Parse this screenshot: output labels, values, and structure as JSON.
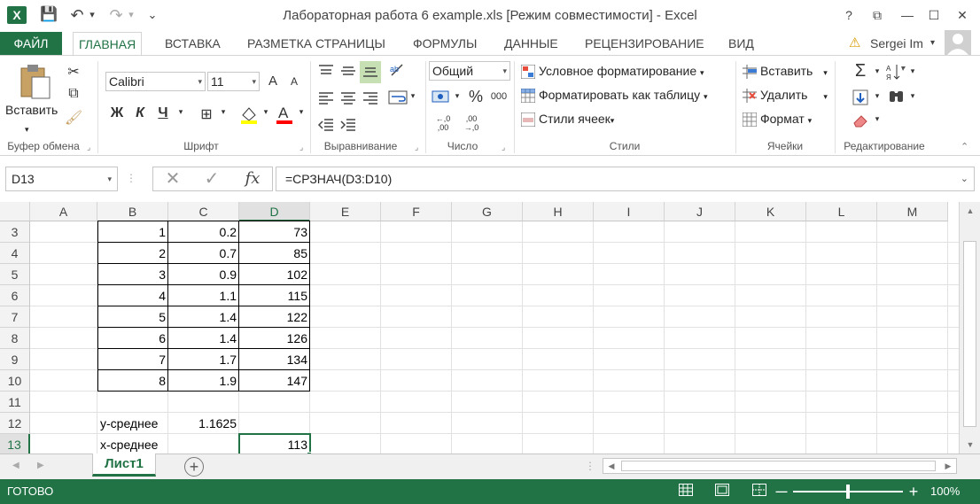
{
  "window": {
    "title": "Лабораторная работа 6 example.xls  [Режим совместимости] - Excel",
    "help": "?",
    "ribbon_options": "⧉",
    "minimize": "—",
    "maximize": "☐",
    "close": "✕"
  },
  "qat": {
    "logo": "X",
    "save": "💾",
    "undo": "↶",
    "undo_drop": "▾",
    "redo": "↷",
    "redo_drop": "▾",
    "customize": "⌄"
  },
  "tabs": {
    "file": "ФАЙЛ",
    "items": [
      "ГЛАВНАЯ",
      "ВСТАВКА",
      "РАЗМЕТКА СТРАНИЦЫ",
      "ФОРМУЛЫ",
      "ДАННЫЕ",
      "РЕЦЕНЗИРОВАНИЕ",
      "ВИД"
    ],
    "active": "ГЛАВНАЯ",
    "user": "Sergei Im",
    "user_arrow": "▾"
  },
  "ribbon": {
    "clipboard": {
      "label": "Буфер обмена",
      "paste": "Вставить"
    },
    "font": {
      "label": "Шрифт",
      "name": "Calibri",
      "size": "11",
      "bold": "Ж",
      "italic": "К",
      "underline": "Ч",
      "grow": "A",
      "shrink": "A"
    },
    "alignment": {
      "label": "Выравнивание"
    },
    "number": {
      "label": "Число",
      "format": "Общий",
      "percent": "%",
      "thousands": "000",
      "inc_decimal": "←,0 ,00",
      "dec_decimal": ",00 →,0"
    },
    "styles": {
      "label": "Стили",
      "conditional": "Условное форматирование",
      "as_table": "Форматировать как таблицу",
      "cell_styles": "Стили ячеек"
    },
    "cells": {
      "label": "Ячейки",
      "insert": "Вставить",
      "delete": "Удалить",
      "format": "Формат"
    },
    "editing": {
      "label": "Редактирование",
      "sum": "Σ",
      "sort": "A Z",
      "find": "🔍"
    },
    "launcher": "⌟"
  },
  "formula_bar": {
    "name_box": "D13",
    "cancel": "✕",
    "enter": "✓",
    "fx": "fx",
    "formula": "=СРЗНАЧ(D3:D10)"
  },
  "sheet": {
    "columns": [
      "A",
      "B",
      "C",
      "D",
      "E",
      "F",
      "G",
      "H",
      "I",
      "J",
      "K",
      "L",
      "M"
    ],
    "selected_column": "D",
    "rows": [
      {
        "num": "3",
        "B": "1",
        "C": "0.2",
        "D": "73"
      },
      {
        "num": "4",
        "B": "2",
        "C": "0.7",
        "D": "85"
      },
      {
        "num": "5",
        "B": "3",
        "C": "0.9",
        "D": "102"
      },
      {
        "num": "6",
        "B": "4",
        "C": "1.1",
        "D": "115"
      },
      {
        "num": "7",
        "B": "5",
        "C": "1.4",
        "D": "122"
      },
      {
        "num": "8",
        "B": "6",
        "C": "1.4",
        "D": "126"
      },
      {
        "num": "9",
        "B": "7",
        "C": "1.7",
        "D": "134"
      },
      {
        "num": "10",
        "B": "8",
        "C": "1.9",
        "D": "147"
      },
      {
        "num": "11",
        "B": "",
        "C": "",
        "D": ""
      },
      {
        "num": "12",
        "B": "y-среднее",
        "C": "1.1625",
        "D": ""
      },
      {
        "num": "13",
        "B": "x-среднее",
        "C": "",
        "D": "113"
      }
    ],
    "selected_row": "13",
    "active_cell": "D13"
  },
  "sheet_tabs": {
    "active": "Лист1",
    "add": "+",
    "prev": "◀",
    "next": "▶"
  },
  "status": {
    "ready": "ГОТОВО",
    "zoom": "100%",
    "zoom_minus": "—",
    "zoom_plus": "+"
  }
}
